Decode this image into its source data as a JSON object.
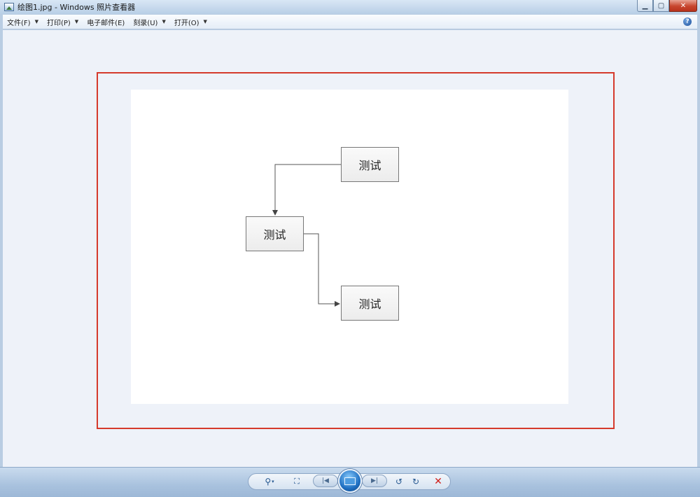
{
  "window": {
    "title": "绘图1.jpg - Windows 照片查看器",
    "controls": [
      "minimize",
      "maximize",
      "close"
    ]
  },
  "menu": {
    "items": [
      {
        "label": "文件(F)",
        "has_dropdown": true
      },
      {
        "label": "打印(P)",
        "has_dropdown": true
      },
      {
        "label": "电子邮件(E)",
        "has_dropdown": false
      },
      {
        "label": "刻录(U)",
        "has_dropdown": true
      },
      {
        "label": "打开(O)",
        "has_dropdown": true
      }
    ],
    "help_glyph": "?"
  },
  "image": {
    "nodes": [
      {
        "id": "node-top-right",
        "label": "测试"
      },
      {
        "id": "node-middle-left",
        "label": "测试"
      },
      {
        "id": "node-bottom-right",
        "label": "测试"
      }
    ],
    "highlight_color": "#d53a2c"
  },
  "toolbar": {
    "buttons": [
      {
        "name": "zoom",
        "icon": "magnifier-icon"
      },
      {
        "name": "actual-size",
        "icon": "fit-window-icon"
      },
      {
        "name": "previous",
        "icon": "previous-icon"
      },
      {
        "name": "slideshow",
        "icon": "slideshow-icon"
      },
      {
        "name": "next",
        "icon": "next-icon"
      },
      {
        "name": "rotate-counterclockwise",
        "icon": "rotate-left-icon"
      },
      {
        "name": "rotate-clockwise",
        "icon": "rotate-right-icon"
      },
      {
        "name": "delete",
        "icon": "delete-icon"
      }
    ],
    "accent_color": "#23568f",
    "delete_color": "#d0201a"
  }
}
